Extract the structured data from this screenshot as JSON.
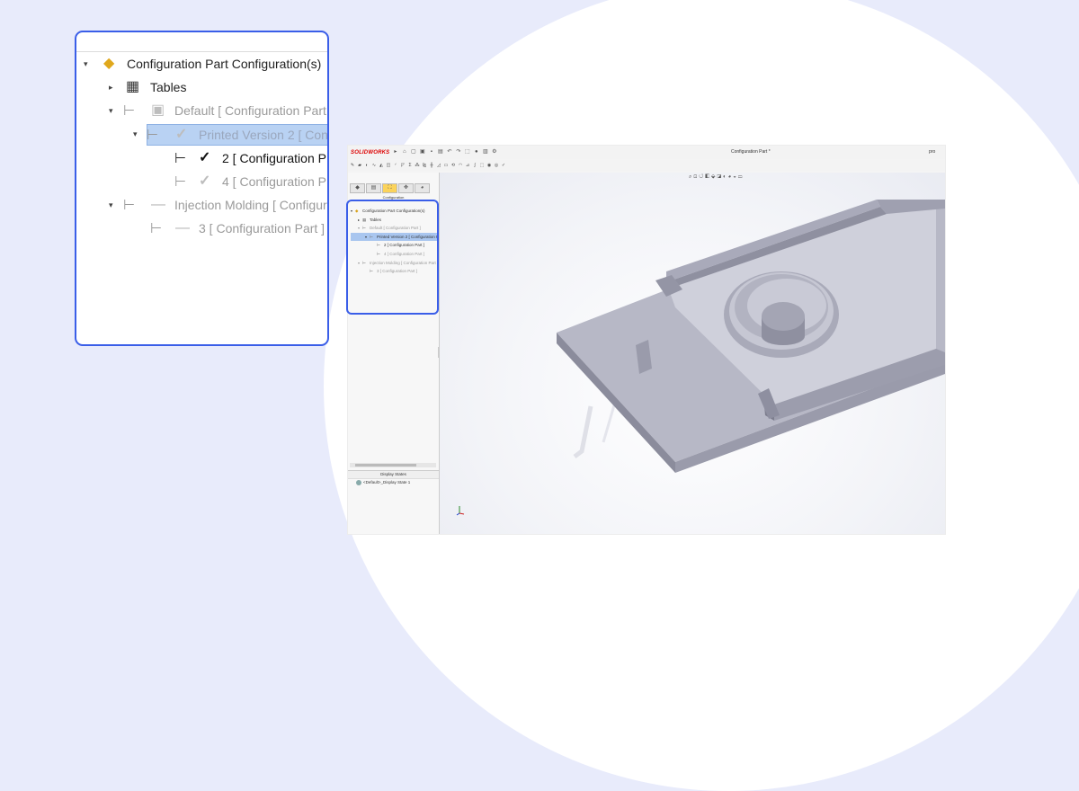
{
  "app": {
    "brand": "SOLIDWORKS",
    "window_title": "Configuration Part *",
    "window_title_right": "pro"
  },
  "panel": {
    "heading": "Configuration",
    "tabs": [
      "feature-manager-icon",
      "property-manager-icon",
      "configuration-manager-icon",
      "dimxpert-icon",
      "display-manager-icon"
    ],
    "tree": [
      {
        "label": "Configuration Part Configuration(s)",
        "indent": 0,
        "caret": "▾"
      },
      {
        "label": "Tables",
        "indent": 1,
        "caret": "▸"
      },
      {
        "label": "Default [ Configuration Part ]",
        "indent": 1,
        "caret": "▾",
        "dim": true
      },
      {
        "label": "Printed Version 2 [ Configuration Part ]",
        "indent": 2,
        "caret": "▾",
        "selected": true
      },
      {
        "label": "2 [ Configuration Part ]",
        "indent": 3,
        "caret": ""
      },
      {
        "label": "4 [ Configuration Part ]",
        "indent": 3,
        "caret": "",
        "dim": true
      },
      {
        "label": "Injection Molding [ Configuration Part ]",
        "indent": 1,
        "caret": "▾",
        "dim": true
      },
      {
        "label": "3 [ Configuration Part ]",
        "indent": 2,
        "caret": "",
        "dim": true
      }
    ],
    "display_states_heading": "Display States",
    "display_state_item": "<Default>_Display State 1"
  },
  "callout": {
    "rows": [
      {
        "label": "Configuration Part Configuration(s)",
        "caret": "▾",
        "icon": "part-icon"
      },
      {
        "label": "Tables",
        "caret": "▸",
        "icon": "table-icon"
      },
      {
        "label": "Default [ Configuration Part",
        "caret": "▾",
        "icon": "save-icon",
        "dim": true
      },
      {
        "label": "Printed Version 2 [ Con",
        "caret": "▾",
        "icon": "check-icon",
        "selected": true
      },
      {
        "label": "2 [ Configuration P",
        "caret": "",
        "icon": "check-icon",
        "bold": true
      },
      {
        "label": "4 [ Configuration P",
        "caret": "",
        "icon": "check-icon",
        "dim": true
      },
      {
        "label": "Injection Molding [ Configur",
        "caret": "▾",
        "icon": "dash-icon",
        "dim": true
      },
      {
        "label": "3 [ Configuration Part ]",
        "caret": "",
        "icon": "dash-icon",
        "dim": true
      }
    ]
  },
  "colors": {
    "accent": "#3a5ee8",
    "background": "#e8ebfb",
    "selection": "#b9d2f3",
    "model": "#9ea0b2"
  }
}
